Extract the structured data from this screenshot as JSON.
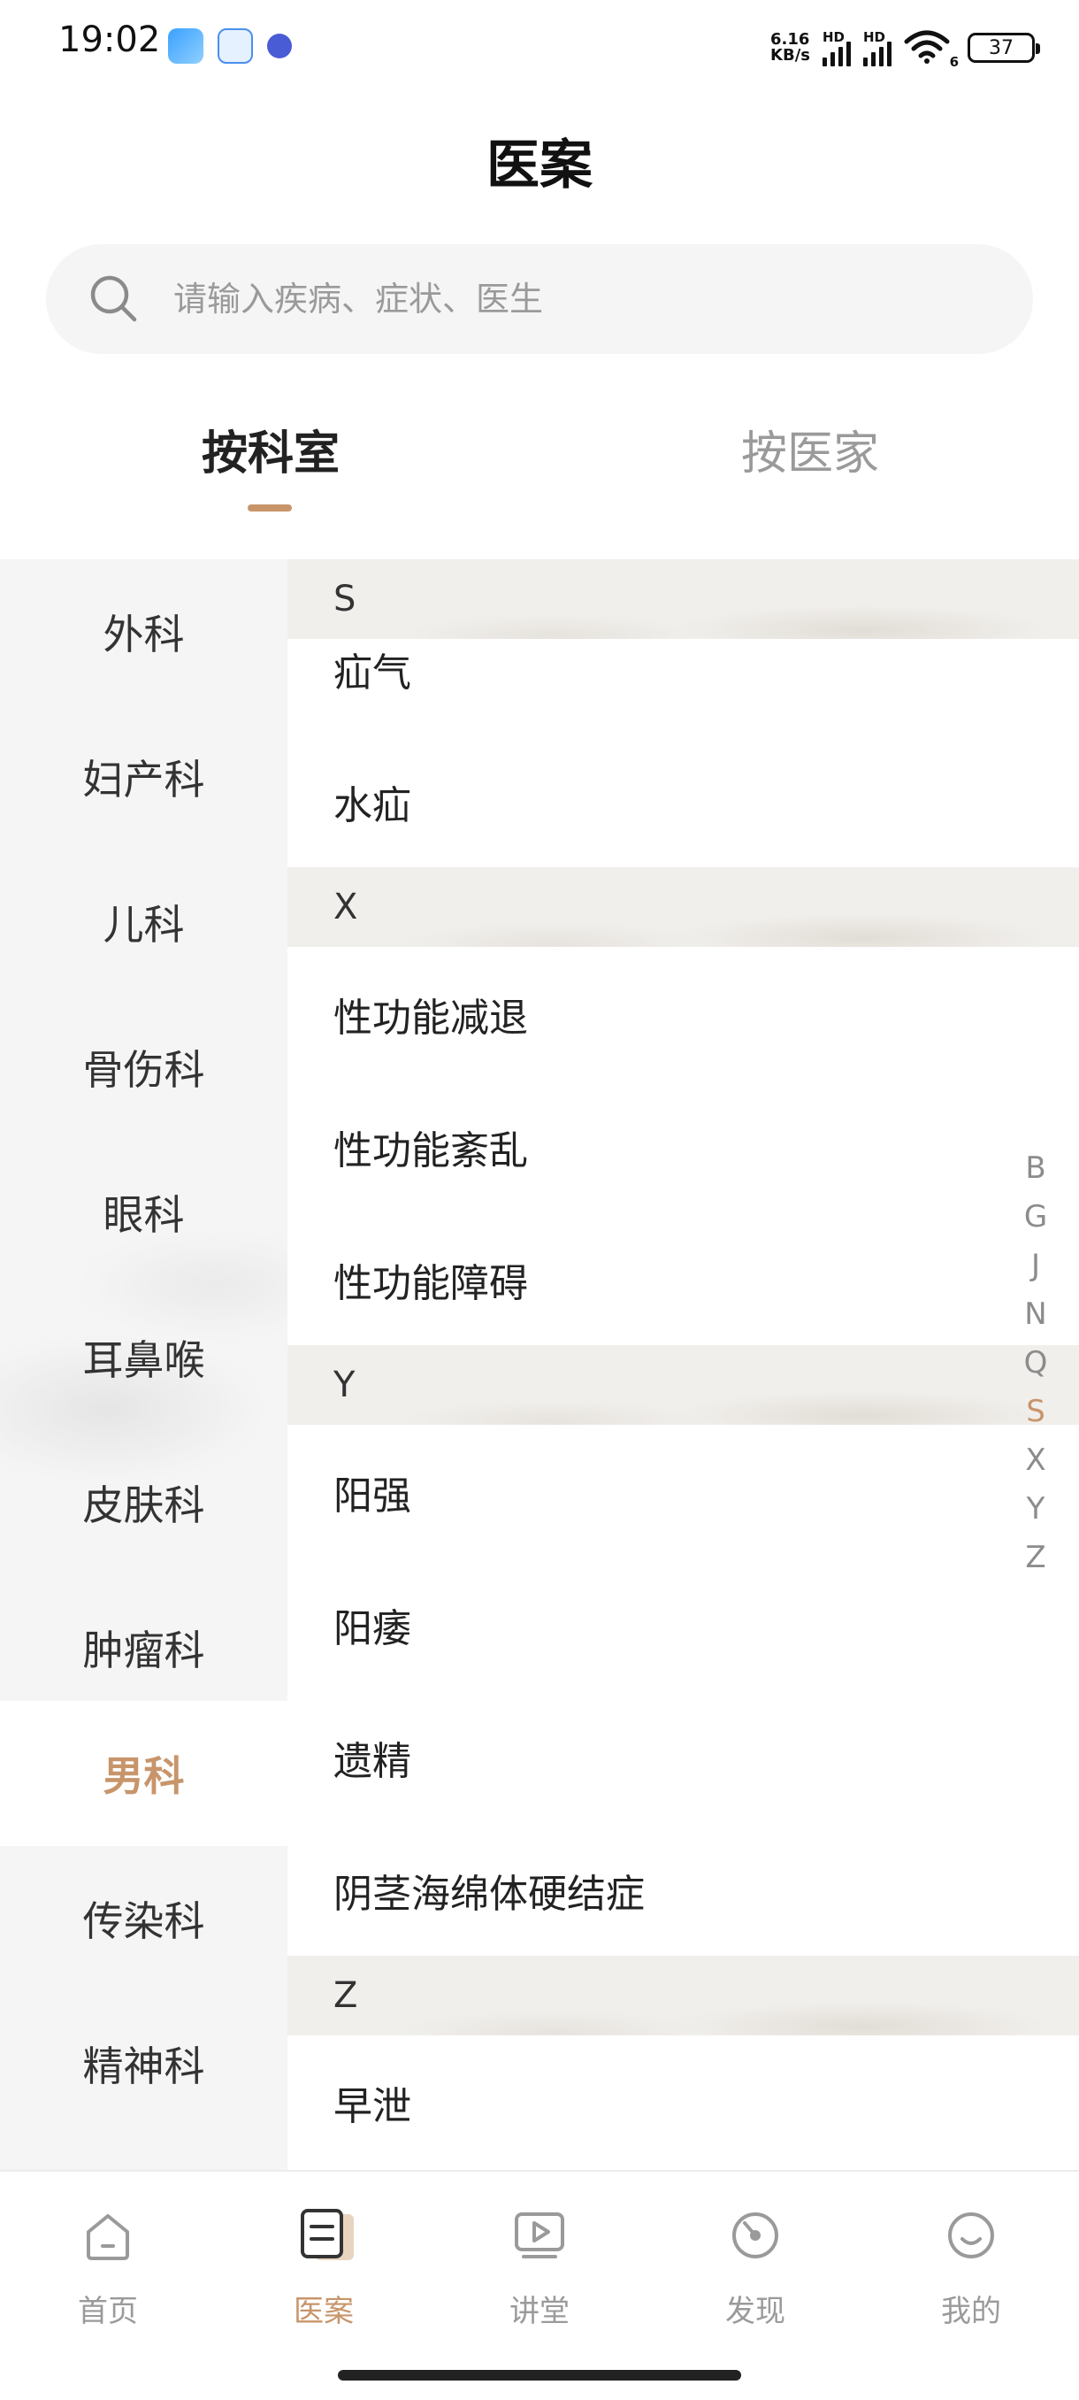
{
  "status_bar": {
    "time": "19:02",
    "net_speed_value": "6.16",
    "net_speed_unit": "KB/s",
    "sim1_label": "HD",
    "sim2_label": "HD",
    "wifi_label": "6",
    "battery": "37"
  },
  "header": {
    "title": "医案"
  },
  "search": {
    "placeholder": "请输入疾病、症状、医生"
  },
  "tabs": [
    {
      "label": "按科室",
      "active": true
    },
    {
      "label": "按医家",
      "active": false
    }
  ],
  "sidebar": {
    "items": [
      {
        "label": "外科"
      },
      {
        "label": "妇产科"
      },
      {
        "label": "儿科"
      },
      {
        "label": "骨伤科"
      },
      {
        "label": "眼科"
      },
      {
        "label": "耳鼻喉"
      },
      {
        "label": "皮肤科"
      },
      {
        "label": "肿瘤科"
      },
      {
        "label": "男科",
        "active": true
      },
      {
        "label": "传染科"
      },
      {
        "label": "精神科"
      }
    ]
  },
  "sections": [
    {
      "letter": "S",
      "items": [
        "疝气",
        "水疝"
      ]
    },
    {
      "letter": "X",
      "items": [
        "性功能减退",
        "性功能紊乱",
        "性功能障碍"
      ]
    },
    {
      "letter": "Y",
      "items": [
        "阳强",
        "阳痿",
        "遗精",
        "阴茎海绵体硬结症"
      ]
    },
    {
      "letter": "Z",
      "items": [
        "早泄"
      ]
    }
  ],
  "alphabet_index": {
    "letters": [
      "B",
      "G",
      "J",
      "N",
      "Q",
      "S",
      "X",
      "Y",
      "Z"
    ],
    "active": "S"
  },
  "bottom_nav": [
    {
      "label": "首页",
      "icon": "home-icon"
    },
    {
      "label": "医案",
      "icon": "case-book-icon",
      "active": true
    },
    {
      "label": "讲堂",
      "icon": "play-video-icon"
    },
    {
      "label": "发现",
      "icon": "discover-icon"
    },
    {
      "label": "我的",
      "icon": "smile-profile-icon"
    }
  ],
  "colors": {
    "accent": "#c8956b",
    "sidebar_bg": "#f5f5f5",
    "section_header_bg": "#f1efec",
    "text_primary": "#222222",
    "text_secondary": "#9a9a9a"
  }
}
